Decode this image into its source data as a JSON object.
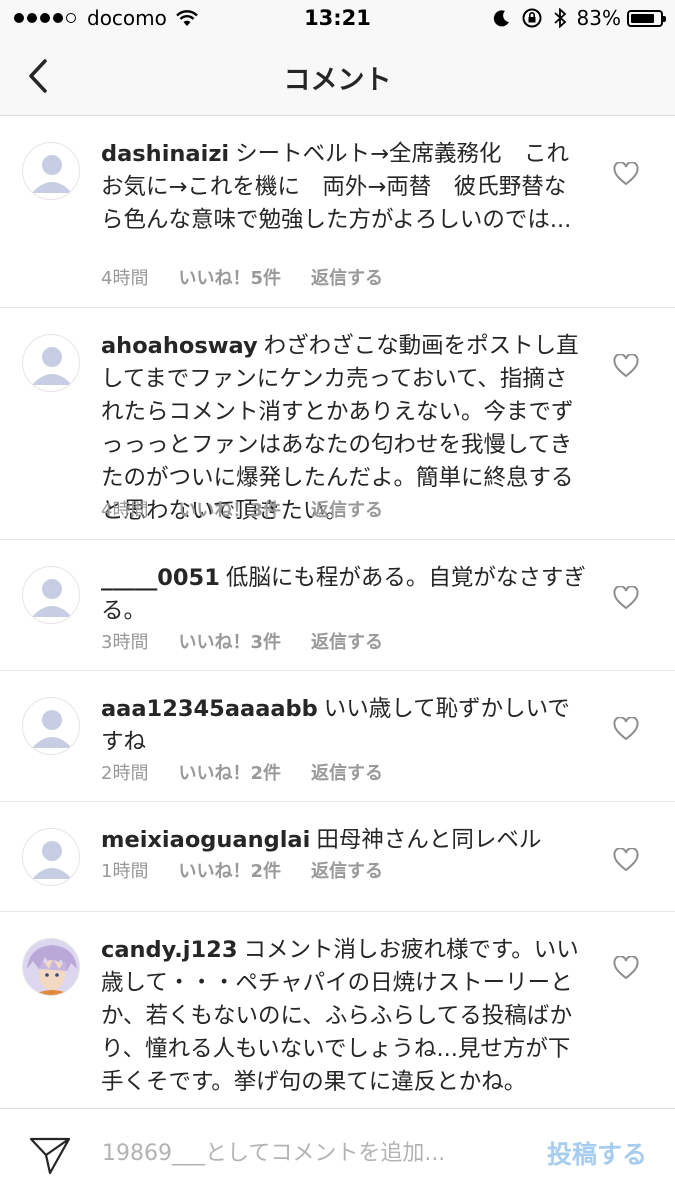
{
  "status_bar": {
    "carrier": "docomo",
    "time": "13:21",
    "battery": "83%",
    "battery_level": 0.83
  },
  "nav": {
    "title": "コメント"
  },
  "comments": [
    {
      "username": "dashinaizi",
      "text": "シートベルト→全席義務化　これお気に→これを機に　両外→両替　彼氏野替なら色んな意味で勉強した方がよろしいのでは...",
      "time": "4時間",
      "likes": "いいね！5件",
      "reply": "返信する",
      "avatar": "default"
    },
    {
      "username": "ahoahosway",
      "text": "わざわざこな動画をポストし直してまでファンにケンカ売っておいて、指摘されたらコメント消すとかありえない。今までずっっっとファンはあなたの匂わせを我慢してきたのがついに爆発したんだよ。簡単に終息すると思わないで頂きたい。",
      "time": "4時間",
      "likes": "いいね！3件",
      "reply": "返信する",
      "avatar": "default"
    },
    {
      "username": "_____0051",
      "text": "低脳にも程がある。自覚がなさすぎる。",
      "time": "3時間",
      "likes": "いいね！3件",
      "reply": "返信する",
      "avatar": "default"
    },
    {
      "username": "aaa12345aaaabb",
      "text": "いい歳して恥ずかしいですね",
      "time": "2時間",
      "likes": "いいね！2件",
      "reply": "返信する",
      "avatar": "default"
    },
    {
      "username": "meixiaoguanglai",
      "text": "田母神さんと同レベル",
      "time": "1時間",
      "likes": "いいね！2件",
      "reply": "返信する",
      "avatar": "default"
    },
    {
      "username": "candy.j123",
      "text": "コメント消しお疲れ様です。いい歳して・・・ペチャパイの日焼けストーリーとか、若くもないのに、ふらふらしてる投稿ばかり、憧れる人もいないでしょうね...見せ方が下手くそです。挙げ句の果てに違反とかね。",
      "time": "",
      "likes": "",
      "reply": "",
      "avatar": "illustrated"
    }
  ],
  "input": {
    "placeholder": "19869___としてコメントを追加...",
    "value": "",
    "post_label": "投稿する"
  },
  "colors": {
    "accent_disabled": "#a6cdf0",
    "meta_text": "#999999",
    "default_avatar": "#c7cde3"
  }
}
